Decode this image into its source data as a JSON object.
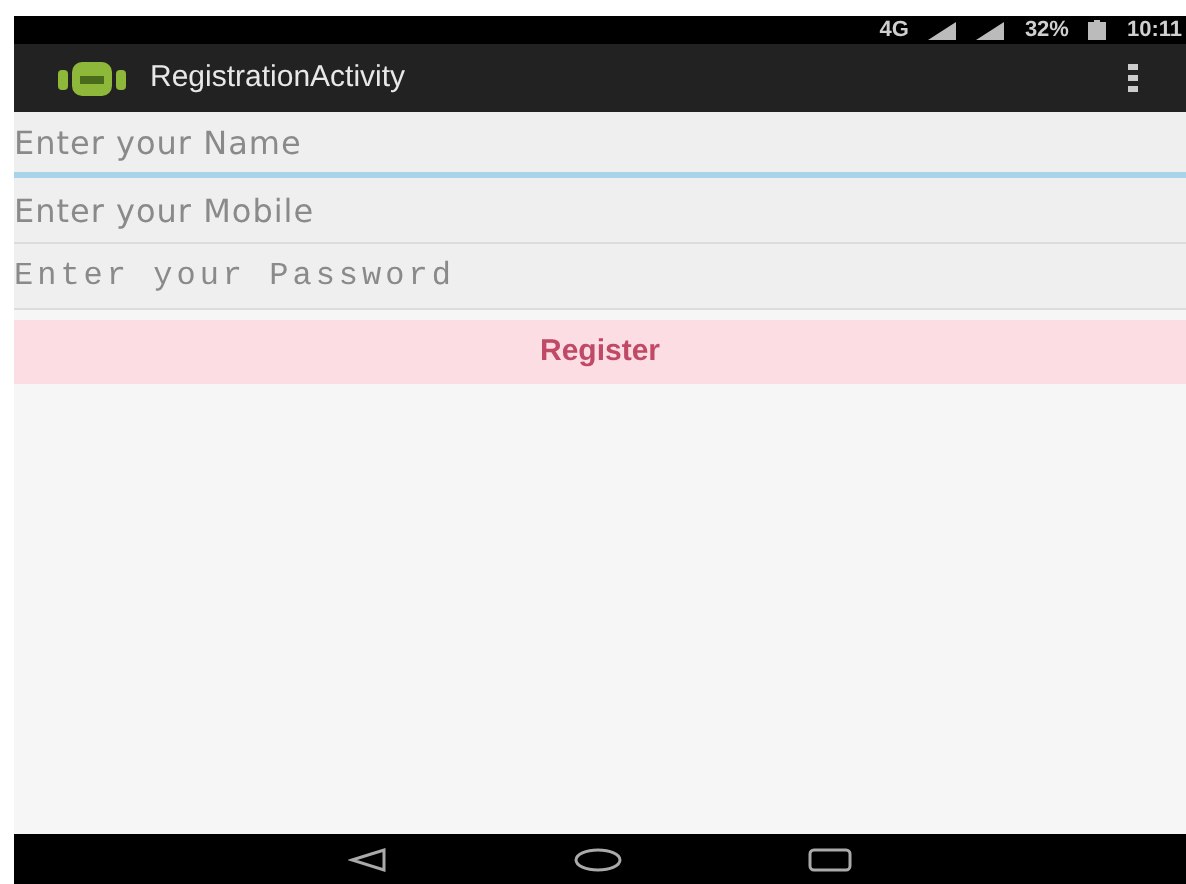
{
  "status_bar": {
    "network": "4G",
    "battery": "32%",
    "time": "10:11"
  },
  "action_bar": {
    "title": "RegistrationActivity"
  },
  "fields": [
    {
      "placeholder": "Enter your Name",
      "kind": "text",
      "focused": true
    },
    {
      "placeholder": "Enter your Mobile",
      "kind": "text",
      "focused": false
    },
    {
      "placeholder": "Enter your Password",
      "kind": "password",
      "focused": false
    }
  ],
  "button": {
    "label": "Register"
  }
}
